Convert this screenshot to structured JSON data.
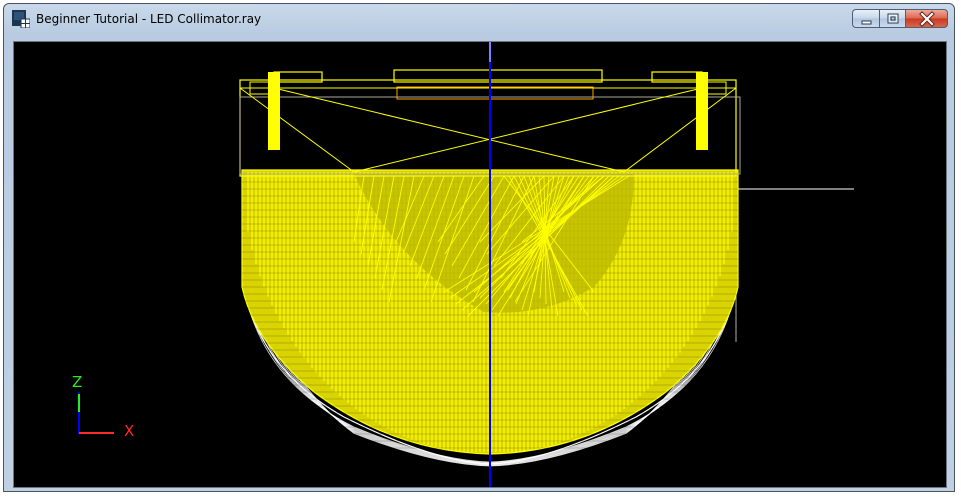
{
  "window": {
    "title": "Beginner Tutorial - LED Collimator.ray",
    "icon": "app-icon"
  },
  "caption_buttons": {
    "minimize": "minimize-icon",
    "maximize": "maximize-icon",
    "close": "close-icon"
  },
  "axes": {
    "vertical_label": "Z",
    "horizontal_label": "X",
    "vertical_color": "#22ee22",
    "horizontal_color": "#ff2a2a"
  },
  "colors": {
    "background": "#000000",
    "rays": "#ffff00",
    "lens": "#ffffff",
    "optical_axis": "#0000ff",
    "housing": "#ffa500"
  }
}
